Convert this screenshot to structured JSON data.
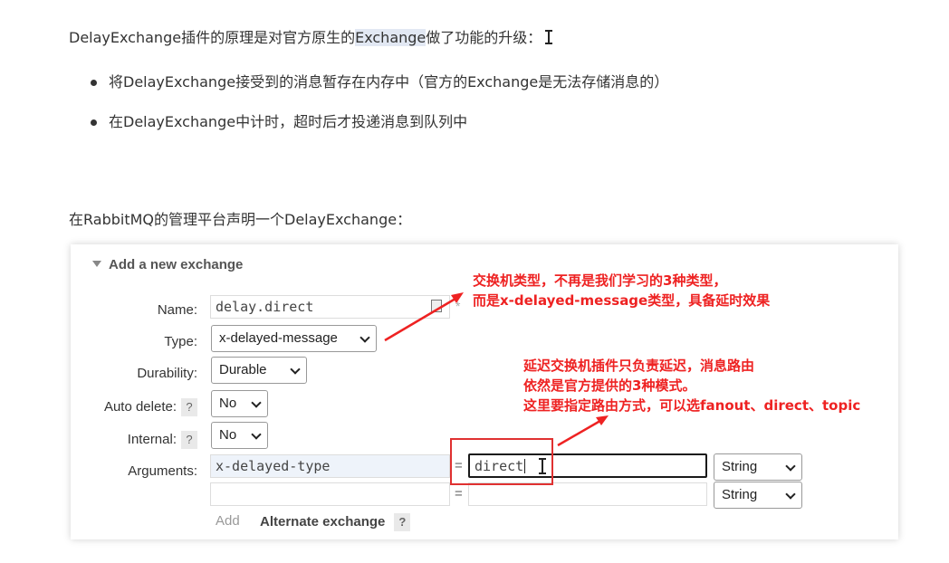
{
  "intro": {
    "before": "DelayExchange插件的原理是对官方原生的",
    "highlight": "Exchange",
    "after": "做了功能的升级："
  },
  "bullets": [
    "将DelayExchange接受到的消息暂存在内存中（官方的Exchange是无法存储消息的）",
    "在DelayExchange中计时，超时后才投递消息到队列中"
  ],
  "section_heading": "在RabbitMQ的管理平台声明一个DelayExchange：",
  "form": {
    "header": "Add a new exchange",
    "name_label": "Name:",
    "name_value": "delay.direct",
    "required_mark": "*",
    "type_label": "Type:",
    "type_value": "x-delayed-message",
    "durability_label": "Durability:",
    "durability_value": "Durable",
    "auto_delete_label": "Auto delete:",
    "auto_delete_value": "No",
    "internal_label": "Internal:",
    "internal_value": "No",
    "help": "?",
    "arguments_label": "Arguments:",
    "eq": "=",
    "arguments": [
      {
        "key": "x-delayed-type",
        "value": "direct",
        "type": "String"
      },
      {
        "key": "",
        "value": "",
        "type": "String"
      }
    ],
    "add_label": "Add",
    "alternate_label": "Alternate exchange"
  },
  "annotations": {
    "type_note": [
      "交换机类型，不再是我们学习的3种类型，",
      "而是x-delayed-message类型，具备延时效果"
    ],
    "routing_note": [
      "延迟交换机插件只负责延迟，消息路由",
      "依然是官方提供的3种模式。",
      "这里要指定路由方式，可以选fanout、direct、topic"
    ]
  },
  "colors": {
    "annotation": "#ee2222",
    "highlight": "#e2e8f3",
    "panel_text": "#333333"
  }
}
